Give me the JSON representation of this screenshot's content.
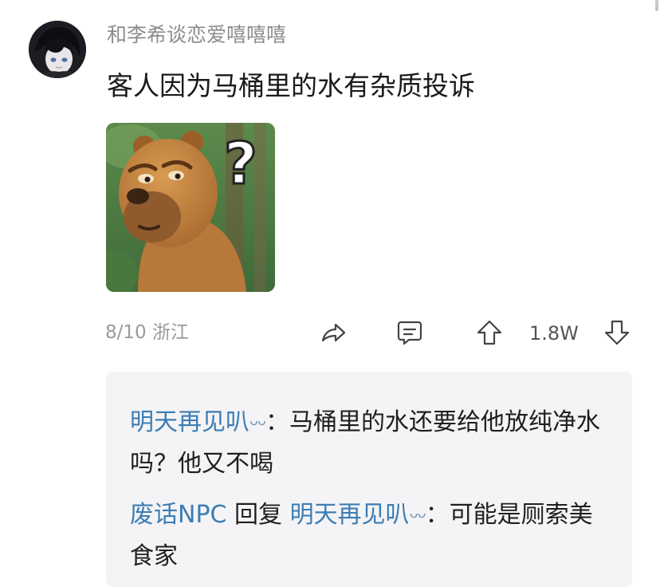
{
  "post": {
    "username": "和李希谈恋爱嘻嘻嘻",
    "text": "客人因为马桶里的水有杂质投诉",
    "image_icon": "bear-question-meme",
    "meta": "8/10 浙江",
    "like_count": "1.8W"
  },
  "actions": {
    "share_icon": "share-icon",
    "comment_icon": "comment-icon",
    "upvote_icon": "upvote-icon",
    "downvote_icon": "downvote-icon"
  },
  "replies": [
    {
      "nickname": "明天再见叭",
      "emoji": "ᴗᴗ",
      "separator": "：",
      "text": "马桶里的水还要给他放纯净水吗？他又不喝"
    },
    {
      "nickname": "废话NPC",
      "reply_word": " 回复 ",
      "target": "明天再见叭",
      "target_emoji": "ᴗᴗ",
      "separator": "：",
      "text": "可能是厕索美食家"
    }
  ],
  "colors": {
    "nickname": "#3d7db4",
    "muted": "#9a9a9a",
    "reply_bg": "#f4f4f6"
  }
}
